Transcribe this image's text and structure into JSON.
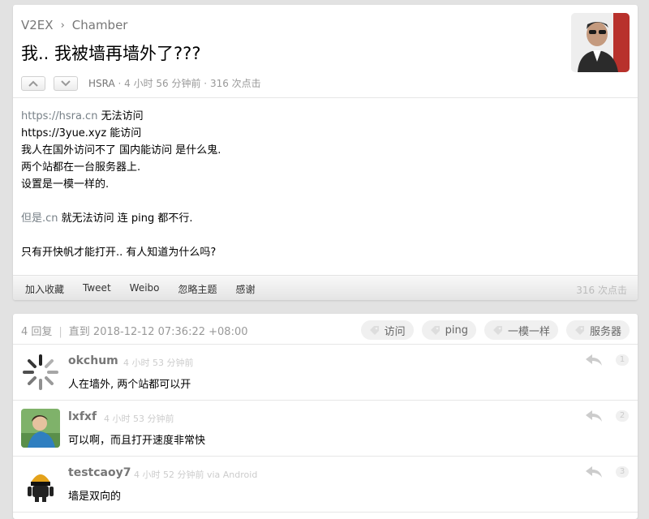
{
  "breadcrumb": {
    "site": "V2EX",
    "separator": "›",
    "node": "Chamber"
  },
  "topic": {
    "title": "我.. 我被墙再墙外了???",
    "author": "HSRA",
    "time": " · 4 小时 56 分钟前 · ",
    "clicks": "316 次点击",
    "content": {
      "line1_link": "https://hsra.cn",
      "line1_rest": " 无法访问",
      "line2": "https://3yue.xyz 能访问",
      "line3": "我人在国外访问不了 国内能访问 是什么鬼.",
      "line4": "两个站都在一台服务器上.",
      "line5": "设置是一模一样的.",
      "line6_link": "但是.cn",
      "line6_rest": " 就无法访问 连 ping 都不行.",
      "line7": "只有开快帆才能打开.. 有人知道为什么吗?"
    },
    "footer": {
      "links": [
        "加入收藏",
        "Tweet",
        "Weibo",
        "忽略主题",
        "感谢"
      ],
      "clicks": "316 次点击"
    }
  },
  "replies_header": {
    "count": "4 回复",
    "separator": "|",
    "until": "直到 2018-12-12 07:36:22 +08:00",
    "tags": [
      "访问",
      "ping",
      "一模一样",
      "服务器"
    ]
  },
  "replies": [
    {
      "user": "okchum",
      "time": "4 小时 53 分钟前",
      "text": "人在墙外, 两个站都可以开",
      "no": "1"
    },
    {
      "user": "lxfxf",
      "time": "4 小时 53 分钟前",
      "text": "可以啊，而且打开速度非常快",
      "no": "2"
    },
    {
      "user": "testcaoy7",
      "time": "4 小时 52 分钟前 via Android",
      "text": "墙是双向的",
      "no": "3"
    }
  ],
  "colors": {
    "background": "#e2e2e2",
    "link_gray": "#778087",
    "muted": "#999999"
  },
  "icons": [
    "vote-up-icon",
    "vote-down-icon",
    "tag-icon",
    "reply-arrow-icon"
  ]
}
